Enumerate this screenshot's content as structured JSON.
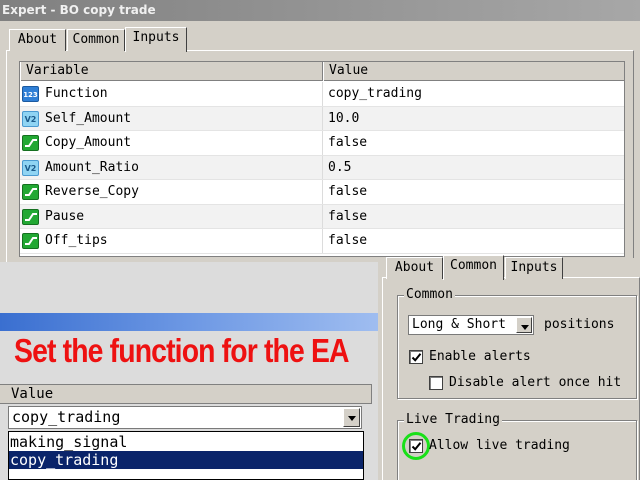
{
  "window": {
    "title": "Expert - BO copy trade"
  },
  "main_tabs": [
    {
      "label": "About",
      "active": false
    },
    {
      "label": "Common",
      "active": false
    },
    {
      "label": "Inputs",
      "active": true
    }
  ],
  "inputs_table": {
    "columns": [
      "Variable",
      "Value"
    ],
    "rows": [
      {
        "icon": "int-type-icon",
        "icon_text": "123",
        "variable": "Function",
        "value": "copy_trading"
      },
      {
        "icon": "double-type-icon",
        "icon_text": "V2",
        "variable": "Self_Amount",
        "value": "10.0"
      },
      {
        "icon": "bool-type-icon",
        "variable": "Copy_Amount",
        "value": "false"
      },
      {
        "icon": "double-type-icon",
        "icon_text": "V2",
        "variable": "Amount_Ratio",
        "value": "0.5"
      },
      {
        "icon": "bool-type-icon",
        "variable": "Reverse_Copy",
        "value": "false"
      },
      {
        "icon": "bool-type-icon",
        "variable": "Pause",
        "value": "false"
      },
      {
        "icon": "bool-type-icon",
        "variable": "Off_tips",
        "value": "false"
      }
    ]
  },
  "caption": {
    "text": "Set the function for the EA",
    "color": "#ee1111"
  },
  "function_combo": {
    "header": "Value",
    "selected": "copy_trading",
    "options": [
      {
        "label": "making_signal",
        "selected": false
      },
      {
        "label": "copy_trading",
        "selected": true
      }
    ]
  },
  "common_panel": {
    "tabs": [
      {
        "label": "About",
        "active": false
      },
      {
        "label": "Common",
        "active": true
      },
      {
        "label": "Inputs",
        "active": false
      }
    ],
    "common_group": {
      "legend": "Common",
      "positions_select": "Long & Short",
      "positions_label": "positions",
      "enable_alerts": {
        "label": "Enable alerts",
        "checked": true
      },
      "disable_alert_once_hit": {
        "label": "Disable alert once hit",
        "checked": false
      }
    },
    "live_trading_group": {
      "legend": "Live Trading",
      "allow_live_trading": {
        "label": "Allow live trading",
        "checked": true
      }
    },
    "highlight_color": "#19e019"
  }
}
